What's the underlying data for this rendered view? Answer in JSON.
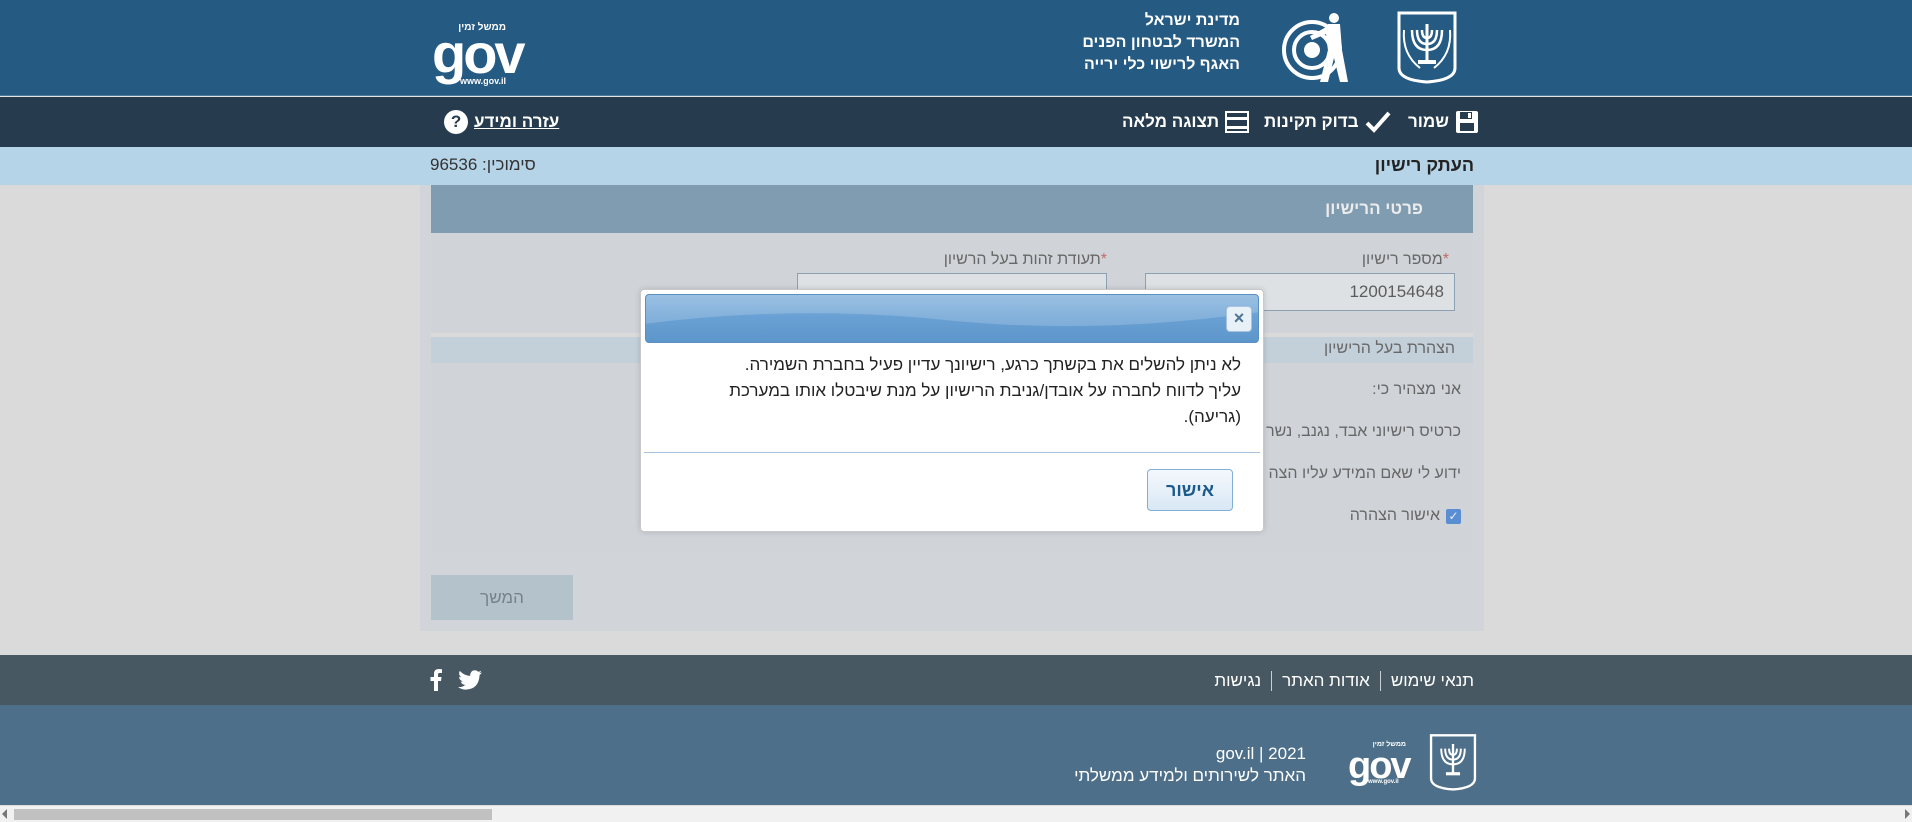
{
  "header": {
    "gov_logo": {
      "small_text": "ממשל זמין",
      "big_text": "gov",
      "url_text": "www.gov.il"
    },
    "ministry_lines": [
      "מדינת ישראל",
      "המשרד לבטחון הפנים",
      "האגף לרישוי כלי ירייה"
    ],
    "icons": [
      "target-shooter-logo",
      "state-emblem-logo"
    ]
  },
  "nav": {
    "save_label": "שמור",
    "check_label": "בדוק תקינות",
    "fullview_label": "תצוגה מלאה",
    "help_label": "עזרה ומידע",
    "help_icon_glyph": "?"
  },
  "title_strip": {
    "page_title": "העתק רישיון",
    "reference": "סימוכין: 96536"
  },
  "form": {
    "section_title": "פרטי הרישיון",
    "license_number_label": "מספר רישיון",
    "license_number_value": "1200154648",
    "owner_id_label": "תעודת זהות בעל הרשיון",
    "required_mark": "*",
    "declaration_title": "הצהרת בעל הרישיון",
    "declaration_lines": [
      "אני מצהיר כי:",
      "כרטיס רישיוני אבד, נגנב, נשר",
      "ידוע לי שאם המידע עליו הצה"
    ],
    "declaration_confirm_label": "אישור הצהרה",
    "declaration_confirm_checked": true,
    "continue_label": "המשך"
  },
  "dialog": {
    "close_glyph": "×",
    "message_lines": [
      "לא ניתן להשלים את בקשתך כרגע, רישיונך עדיין פעיל בחברת השמירה.",
      "עליך לדווח לחברה על אובדן/גניבת הרישיון על מנת שיבטלו אותו במערכת",
      "(גריעה)."
    ],
    "ok_label": "אישור"
  },
  "footer": {
    "links": [
      "תנאי שימוש",
      "אודות האתר",
      "נגישות"
    ],
    "social_icons": [
      "facebook-icon",
      "twitter-icon"
    ],
    "copyright_line": "2021  |  gov.il",
    "tagline": "האתר לשירותים ולמידע ממשלתי",
    "gov_logo": {
      "small_text": "ממשל זמין",
      "big_text": "gov",
      "url_text": "www.gov.il"
    }
  },
  "colors": {
    "header_bg": "#255a83",
    "nav_bg": "#263c4e",
    "title_strip_bg": "#b6d4e7",
    "section_header_bg": "#5a84a4",
    "dialog_titlebar": "#6aa1d4",
    "footer_links_bg": "#475862",
    "footer_bottom_bg": "#4d6f89"
  }
}
